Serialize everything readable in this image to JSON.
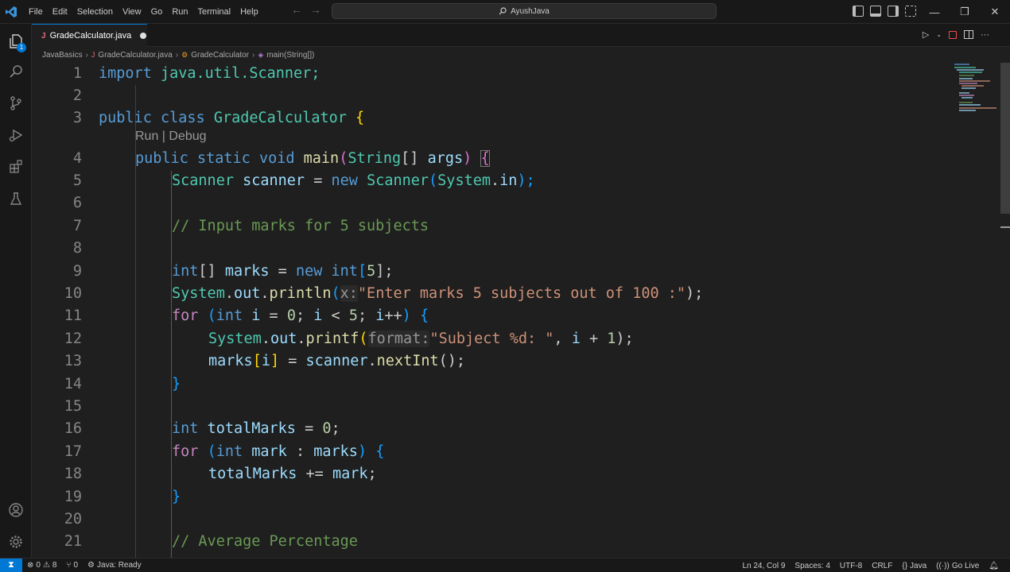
{
  "menu": [
    "File",
    "Edit",
    "Selection",
    "View",
    "Go",
    "Run",
    "Terminal",
    "Help"
  ],
  "search": {
    "label": "AyushJava"
  },
  "tab": {
    "name": "GradeCalculator.java",
    "icon_letter": "J"
  },
  "breadcrumb": [
    "JavaBasics",
    "GradeCalculator.java",
    "GradeCalculator",
    "main(String[])"
  ],
  "activity": {
    "explorer_badge": "1"
  },
  "codelens": "Run | Debug",
  "line_numbers": [
    "1",
    "2",
    "3",
    "4",
    "5",
    "6",
    "7",
    "8",
    "9",
    "10",
    "11",
    "12",
    "13",
    "14",
    "15",
    "16",
    "17",
    "18",
    "19",
    "20",
    "21"
  ],
  "code": {
    "l1": [
      "import",
      " java.util.Scanner;"
    ],
    "l3": [
      "public",
      " ",
      "class",
      " ",
      "GradeCalculator",
      " ",
      "{"
    ],
    "l4": [
      "public",
      " ",
      "static",
      " ",
      "void",
      " ",
      "main",
      "(",
      "String",
      "[]",
      " ",
      "args",
      ")",
      " ",
      "{"
    ],
    "l5": [
      "Scanner",
      " ",
      "scanner",
      " = ",
      "new",
      " ",
      "Scanner",
      "(",
      "System",
      ".",
      "in",
      ");"
    ],
    "l7": "// Input marks for 5 subjects",
    "l9": [
      "int",
      "[]",
      " ",
      "marks",
      " = ",
      "new",
      " ",
      "int",
      "[",
      "5",
      "];"
    ],
    "l10": [
      "System",
      ".",
      "out",
      ".",
      "println",
      "(",
      "x:",
      "\"Enter marks 5 subjects out of 100 :\"",
      ");"
    ],
    "l11": [
      "for",
      " ",
      "(",
      "int",
      " ",
      "i",
      " = ",
      "0",
      "; ",
      "i",
      " < ",
      "5",
      "; ",
      "i",
      "++",
      ")",
      " ",
      "{"
    ],
    "l12": [
      "System",
      ".",
      "out",
      ".",
      "printf",
      "(",
      "format:",
      "\"Subject %d: \"",
      ", ",
      "i",
      " + ",
      "1",
      ");"
    ],
    "l13": [
      "marks",
      "[",
      "i",
      "]",
      " = ",
      "scanner",
      ".",
      "nextInt",
      "();"
    ],
    "l14": "}",
    "l16": [
      "int",
      " ",
      "totalMarks",
      " = ",
      "0",
      ";"
    ],
    "l17": [
      "for",
      " ",
      "(",
      "int",
      " ",
      "mark",
      " : ",
      "marks",
      ")",
      " ",
      "{"
    ],
    "l18": [
      "totalMarks",
      " += ",
      "mark",
      ";"
    ],
    "l19": "}",
    "l21": "// Average Percentage"
  },
  "status": {
    "errors": "0",
    "warnings": "8",
    "ports": "0",
    "java": "Java: Ready",
    "position": "Ln 24, Col 9",
    "spaces": "Spaces: 4",
    "encoding": "UTF-8",
    "eol": "CRLF",
    "language": "Java",
    "golive": "Go Live"
  },
  "colors": {
    "accent": "#0078d4",
    "keyword": "#569cd6",
    "type": "#4ec9b0",
    "string": "#ce9178",
    "comment": "#6a9955"
  }
}
